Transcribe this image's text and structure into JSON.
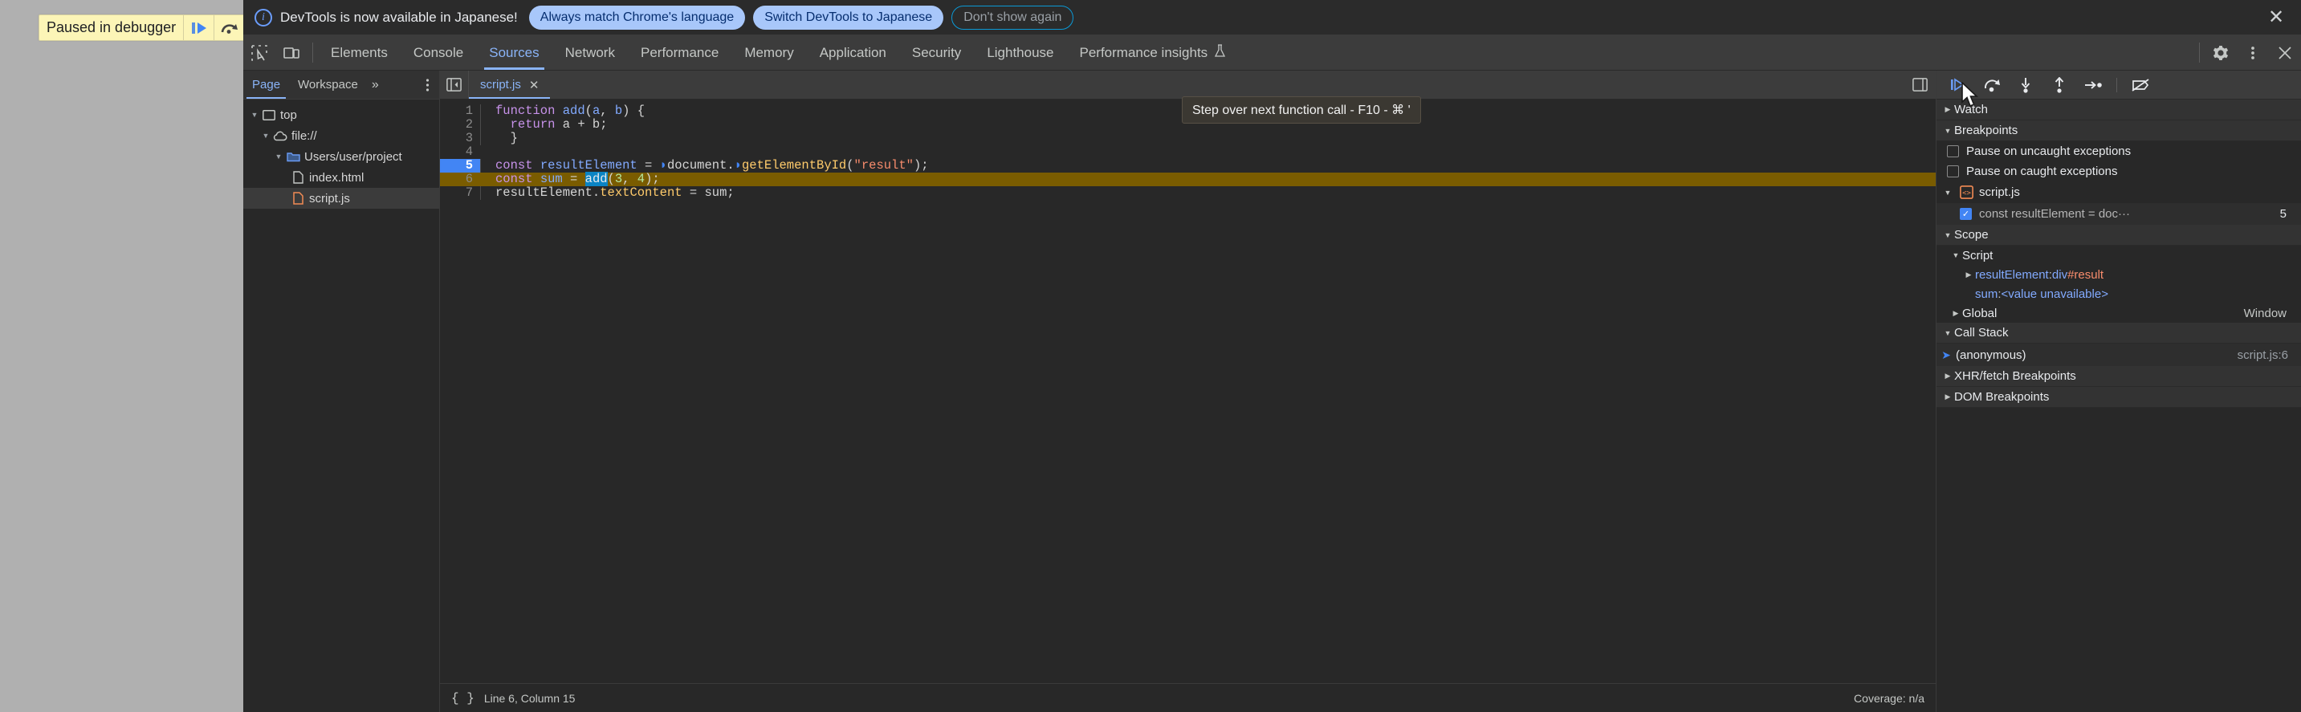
{
  "page": {
    "paused_banner": {
      "label": "Paused in debugger",
      "resume_icon": "resume-script-execution-icon",
      "step_icon": "step-over-icon"
    }
  },
  "infobar": {
    "icon": "info-icon",
    "message": "DevTools is now available in Japanese!",
    "buttons": [
      {
        "label": "Always match Chrome's language",
        "style": "primary"
      },
      {
        "label": "Switch DevTools to Japanese",
        "style": "primary"
      },
      {
        "label": "Don't show again",
        "style": "outline"
      }
    ],
    "close_icon": "close-icon",
    "accent_primary": "#a8c7fa",
    "accent_outline": "#0b99d6"
  },
  "tabbar": {
    "inspect_icon": "inspect-element-icon",
    "device_icon": "device-toolbar-icon",
    "tabs": [
      {
        "label": "Elements",
        "active": false
      },
      {
        "label": "Console",
        "active": false
      },
      {
        "label": "Sources",
        "active": true
      },
      {
        "label": "Network",
        "active": false
      },
      {
        "label": "Performance",
        "active": false
      },
      {
        "label": "Memory",
        "active": false
      },
      {
        "label": "Application",
        "active": false
      },
      {
        "label": "Security",
        "active": false
      },
      {
        "label": "Lighthouse",
        "active": false
      },
      {
        "label": "Performance insights",
        "active": false,
        "badge": "flask"
      }
    ],
    "settings_icon": "gear-icon",
    "more_icon": "more-vertical-icon",
    "close_icon": "close-icon",
    "active_color": "#8ab4f8"
  },
  "navigator": {
    "tabs": [
      {
        "label": "Page",
        "active": true
      },
      {
        "label": "Workspace",
        "active": false
      }
    ],
    "more_label": "»",
    "menu_icon": "more-vertical-icon",
    "tree": [
      {
        "label": "top",
        "depth": 0,
        "icon": "frame-icon",
        "expanded": true,
        "selected": false
      },
      {
        "label": "file://",
        "depth": 1,
        "icon": "cloud-icon",
        "expanded": true,
        "selected": false
      },
      {
        "label": "Users/user/project",
        "depth": 2,
        "icon": "folder-icon",
        "expanded": true,
        "selected": false
      },
      {
        "label": "index.html",
        "depth": 3,
        "icon": "file-html-icon",
        "expanded": null,
        "selected": false
      },
      {
        "label": "script.js",
        "depth": 3,
        "icon": "file-js-icon",
        "expanded": null,
        "selected": true
      }
    ]
  },
  "editor": {
    "collapse_icon": "collapse-sidebar-icon",
    "tab": {
      "label": "script.js",
      "close_icon": "close-icon"
    },
    "popout_icon": "show-navigator-icon",
    "lines": [
      {
        "n": 1,
        "exec": false,
        "hl": false,
        "tokens": [
          {
            "t": "function ",
            "c": "kw"
          },
          {
            "t": "add",
            "c": "fn"
          },
          {
            "t": "(",
            "c": "plain"
          },
          {
            "t": "a",
            "c": "var"
          },
          {
            "t": ", ",
            "c": "plain"
          },
          {
            "t": "b",
            "c": "var"
          },
          {
            "t": ") {",
            "c": "plain"
          }
        ]
      },
      {
        "n": 2,
        "exec": false,
        "hl": false,
        "tokens": [
          {
            "t": "  ",
            "c": "plain"
          },
          {
            "t": "return",
            "c": "kw"
          },
          {
            "t": " a + b;",
            "c": "plain"
          }
        ]
      },
      {
        "n": 3,
        "exec": false,
        "hl": false,
        "tokens": [
          {
            "t": "  }",
            "c": "plain"
          }
        ]
      },
      {
        "n": 4,
        "exec": false,
        "hl": false,
        "tokens": [
          {
            "t": "",
            "c": "plain"
          }
        ]
      },
      {
        "n": 5,
        "exec": true,
        "hl": false,
        "tokens": [
          {
            "t": "const",
            "c": "kw"
          },
          {
            "t": " resultElement ",
            "c": "var"
          },
          {
            "t": "= ",
            "c": "plain"
          },
          {
            "t": "◗",
            "c": "marker"
          },
          {
            "t": "document.",
            "c": "plain"
          },
          {
            "t": "◗",
            "c": "marker"
          },
          {
            "t": "getElementById",
            "c": "prop"
          },
          {
            "t": "(",
            "c": "plain"
          },
          {
            "t": "\"result\"",
            "c": "str"
          },
          {
            "t": ");",
            "c": "plain"
          }
        ]
      },
      {
        "n": 6,
        "exec": false,
        "hl": true,
        "tokens": [
          {
            "t": "const",
            "c": "kw"
          },
          {
            "t": " sum ",
            "c": "var"
          },
          {
            "t": "= ",
            "c": "plain"
          },
          {
            "t": "add",
            "c": "sel"
          },
          {
            "t": "(",
            "c": "plain"
          },
          {
            "t": "3",
            "c": "num"
          },
          {
            "t": ", ",
            "c": "plain"
          },
          {
            "t": "4",
            "c": "num"
          },
          {
            "t": ");",
            "c": "plain"
          }
        ]
      },
      {
        "n": 7,
        "exec": false,
        "hl": false,
        "tokens": [
          {
            "t": "resultElement.",
            "c": "plain"
          },
          {
            "t": "textContent",
            "c": "prop"
          },
          {
            "t": " = sum;",
            "c": "plain"
          }
        ]
      }
    ],
    "status": {
      "brace_icon": "pretty-print-icon",
      "position": "Line 6, Column 15",
      "coverage": "Coverage: n/a"
    }
  },
  "debugger": {
    "toolbar": [
      {
        "name": "resume-script-execution-icon",
        "tooltip": null
      },
      {
        "name": "step-over-icon",
        "tooltip": "Step over next function call - F10 - ⌘ '"
      },
      {
        "name": "step-into-icon",
        "tooltip": null
      },
      {
        "name": "step-out-icon",
        "tooltip": null
      },
      {
        "name": "step-icon",
        "tooltip": null
      },
      {
        "name": "deactivate-breakpoints-icon",
        "tooltip": null
      }
    ],
    "tooltip_text": "Step over next function call - F10 - ⌘ '",
    "sections": {
      "watch": {
        "title": "Watch",
        "expanded": false
      },
      "breakpoints": {
        "title": "Breakpoints",
        "expanded": true,
        "options": [
          {
            "label": "Pause on uncaught exceptions",
            "checked": false
          },
          {
            "label": "Pause on caught exceptions",
            "checked": false
          }
        ],
        "files": [
          {
            "name": "script.js",
            "icon": "file-js-icon",
            "expanded": true,
            "items": [
              {
                "label": "const resultElement = doc···",
                "line": "5",
                "checked": true
              }
            ]
          }
        ]
      },
      "scope": {
        "title": "Scope",
        "expanded": true,
        "groups": [
          {
            "title": "Script",
            "expanded": true,
            "rows": [
              {
                "expandable": true,
                "name": "resultElement",
                "sep": ": ",
                "value": "div",
                "value_id": "#result"
              },
              {
                "expandable": false,
                "name": "sum",
                "sep": ": ",
                "value": "<value unavailable>",
                "value_id": ""
              }
            ]
          },
          {
            "title": "Global",
            "expanded": false,
            "right": "Window",
            "rows": []
          }
        ]
      },
      "callstack": {
        "title": "Call Stack",
        "expanded": true,
        "frames": [
          {
            "label": "(anonymous)",
            "location": "script.js:6",
            "current": true
          }
        ]
      },
      "xhr": {
        "title": "XHR/fetch Breakpoints",
        "expanded": false
      },
      "dom": {
        "title": "DOM Breakpoints",
        "expanded": false
      }
    }
  }
}
